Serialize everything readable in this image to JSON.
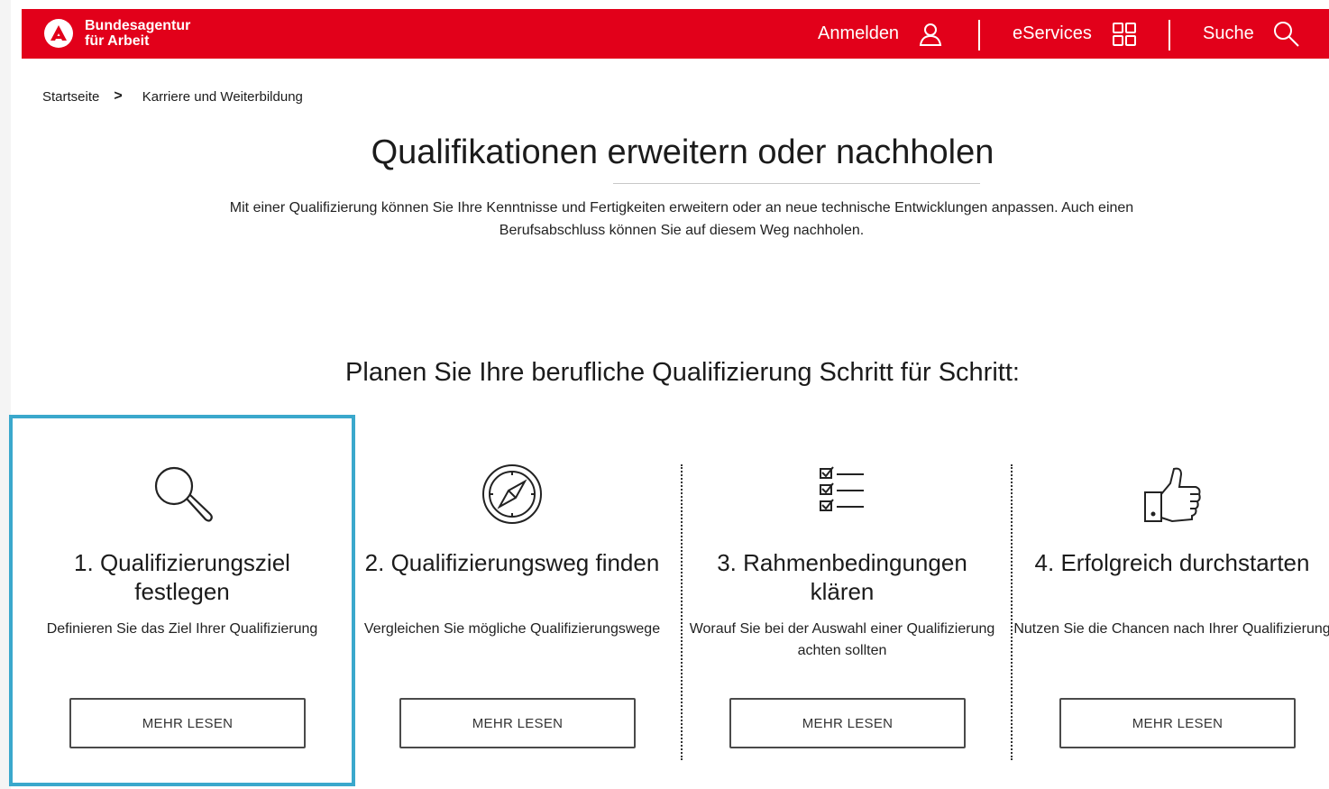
{
  "header": {
    "logo_line1": "Bundesagentur",
    "logo_line2": "für Arbeit",
    "login_label": "Anmelden",
    "login_icon": "user-icon",
    "eservices_label": "eServices",
    "eservices_icon": "grid-icon",
    "search_label": "Suche",
    "search_icon": "search-icon",
    "brand_color": "#e2001a"
  },
  "breadcrumb": {
    "items": [
      "Startseite",
      "Karriere und Weiterbildung"
    ],
    "separator": ">"
  },
  "main": {
    "title": "Qualifikationen erweitern oder nachholen",
    "intro": "Mit einer Qualifizierung können Sie Ihre Kenntnisse und Fertigkeiten erweitern oder an neue technische Entwicklungen anpassen. Auch einen Berufsabschluss können Sie auf diesem Weg nachholen.",
    "section_title": "Planen Sie Ihre berufliche Qualifizierung Schritt für Schritt:"
  },
  "steps": [
    {
      "title": "1. Qualifizierungsziel festlegen",
      "description": "Definieren Sie das Ziel Ihrer Qualifizierung",
      "button": "MEHR LESEN",
      "icon": "magnifier-icon",
      "selected": true
    },
    {
      "title": "2. Qualifizierungsweg finden",
      "description": "Vergleichen Sie mögliche Qualifizierungswege",
      "button": "MEHR LESEN",
      "icon": "compass-icon",
      "selected": false
    },
    {
      "title": "3. Rahmenbedingungen klären",
      "description": "Worauf Sie bei der Auswahl einer Qualifizierung achten sollten",
      "button": "MEHR LESEN",
      "icon": "checklist-icon",
      "selected": false
    },
    {
      "title": "4. Erfolgreich durchstarten",
      "description": "Nutzen Sie die Chancen nach Ihrer Qualifizierung",
      "button": "MEHR LESEN",
      "icon": "thumbs-up-icon",
      "selected": false
    }
  ],
  "colors": {
    "selection_outline": "#3aa8cc",
    "text": "#1b1b1b"
  }
}
